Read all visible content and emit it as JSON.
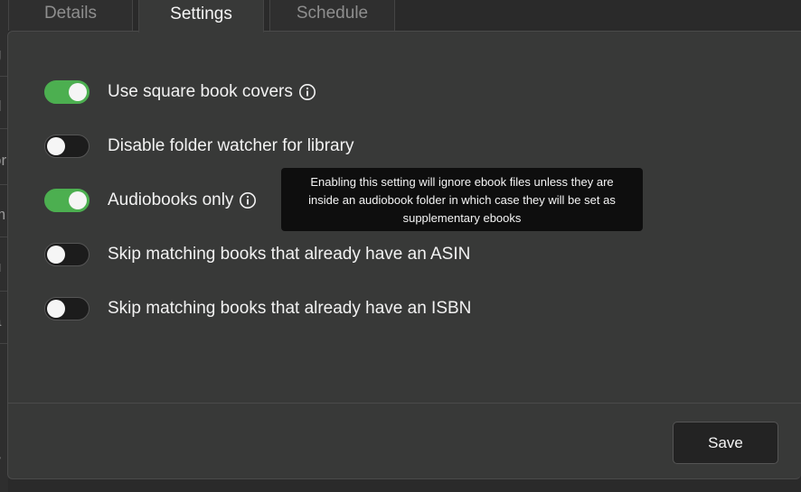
{
  "background": {
    "fragments": [
      "g",
      "d",
      "or",
      "m",
      "u",
      "a",
      "c",
      "v",
      "w"
    ]
  },
  "tabs": [
    {
      "label": "Details"
    },
    {
      "label": "Settings",
      "active": true
    },
    {
      "label": "Schedule"
    }
  ],
  "settings": [
    {
      "label": "Use square book covers",
      "enabled": true,
      "has_info": true
    },
    {
      "label": "Disable folder watcher for library",
      "enabled": false,
      "has_info": false
    },
    {
      "label": "Audiobooks only",
      "enabled": true,
      "has_info": true
    },
    {
      "label": "Skip matching books that already have an ASIN",
      "enabled": false,
      "has_info": false
    },
    {
      "label": "Skip matching books that already have an ISBN",
      "enabled": false,
      "has_info": false
    }
  ],
  "tooltip": {
    "line1": "Enabling this setting will ignore ebook files unless they are",
    "line2": "inside an audiobook folder in which case they will be set as",
    "line3": "supplementary ebooks"
  },
  "footer": {
    "save_label": "Save"
  },
  "colors": {
    "toggle_on": "#4caf50",
    "panel": "#383938",
    "tooltip_bg": "#0e0e0e"
  },
  "icons": {
    "info": "info-circle-icon"
  }
}
